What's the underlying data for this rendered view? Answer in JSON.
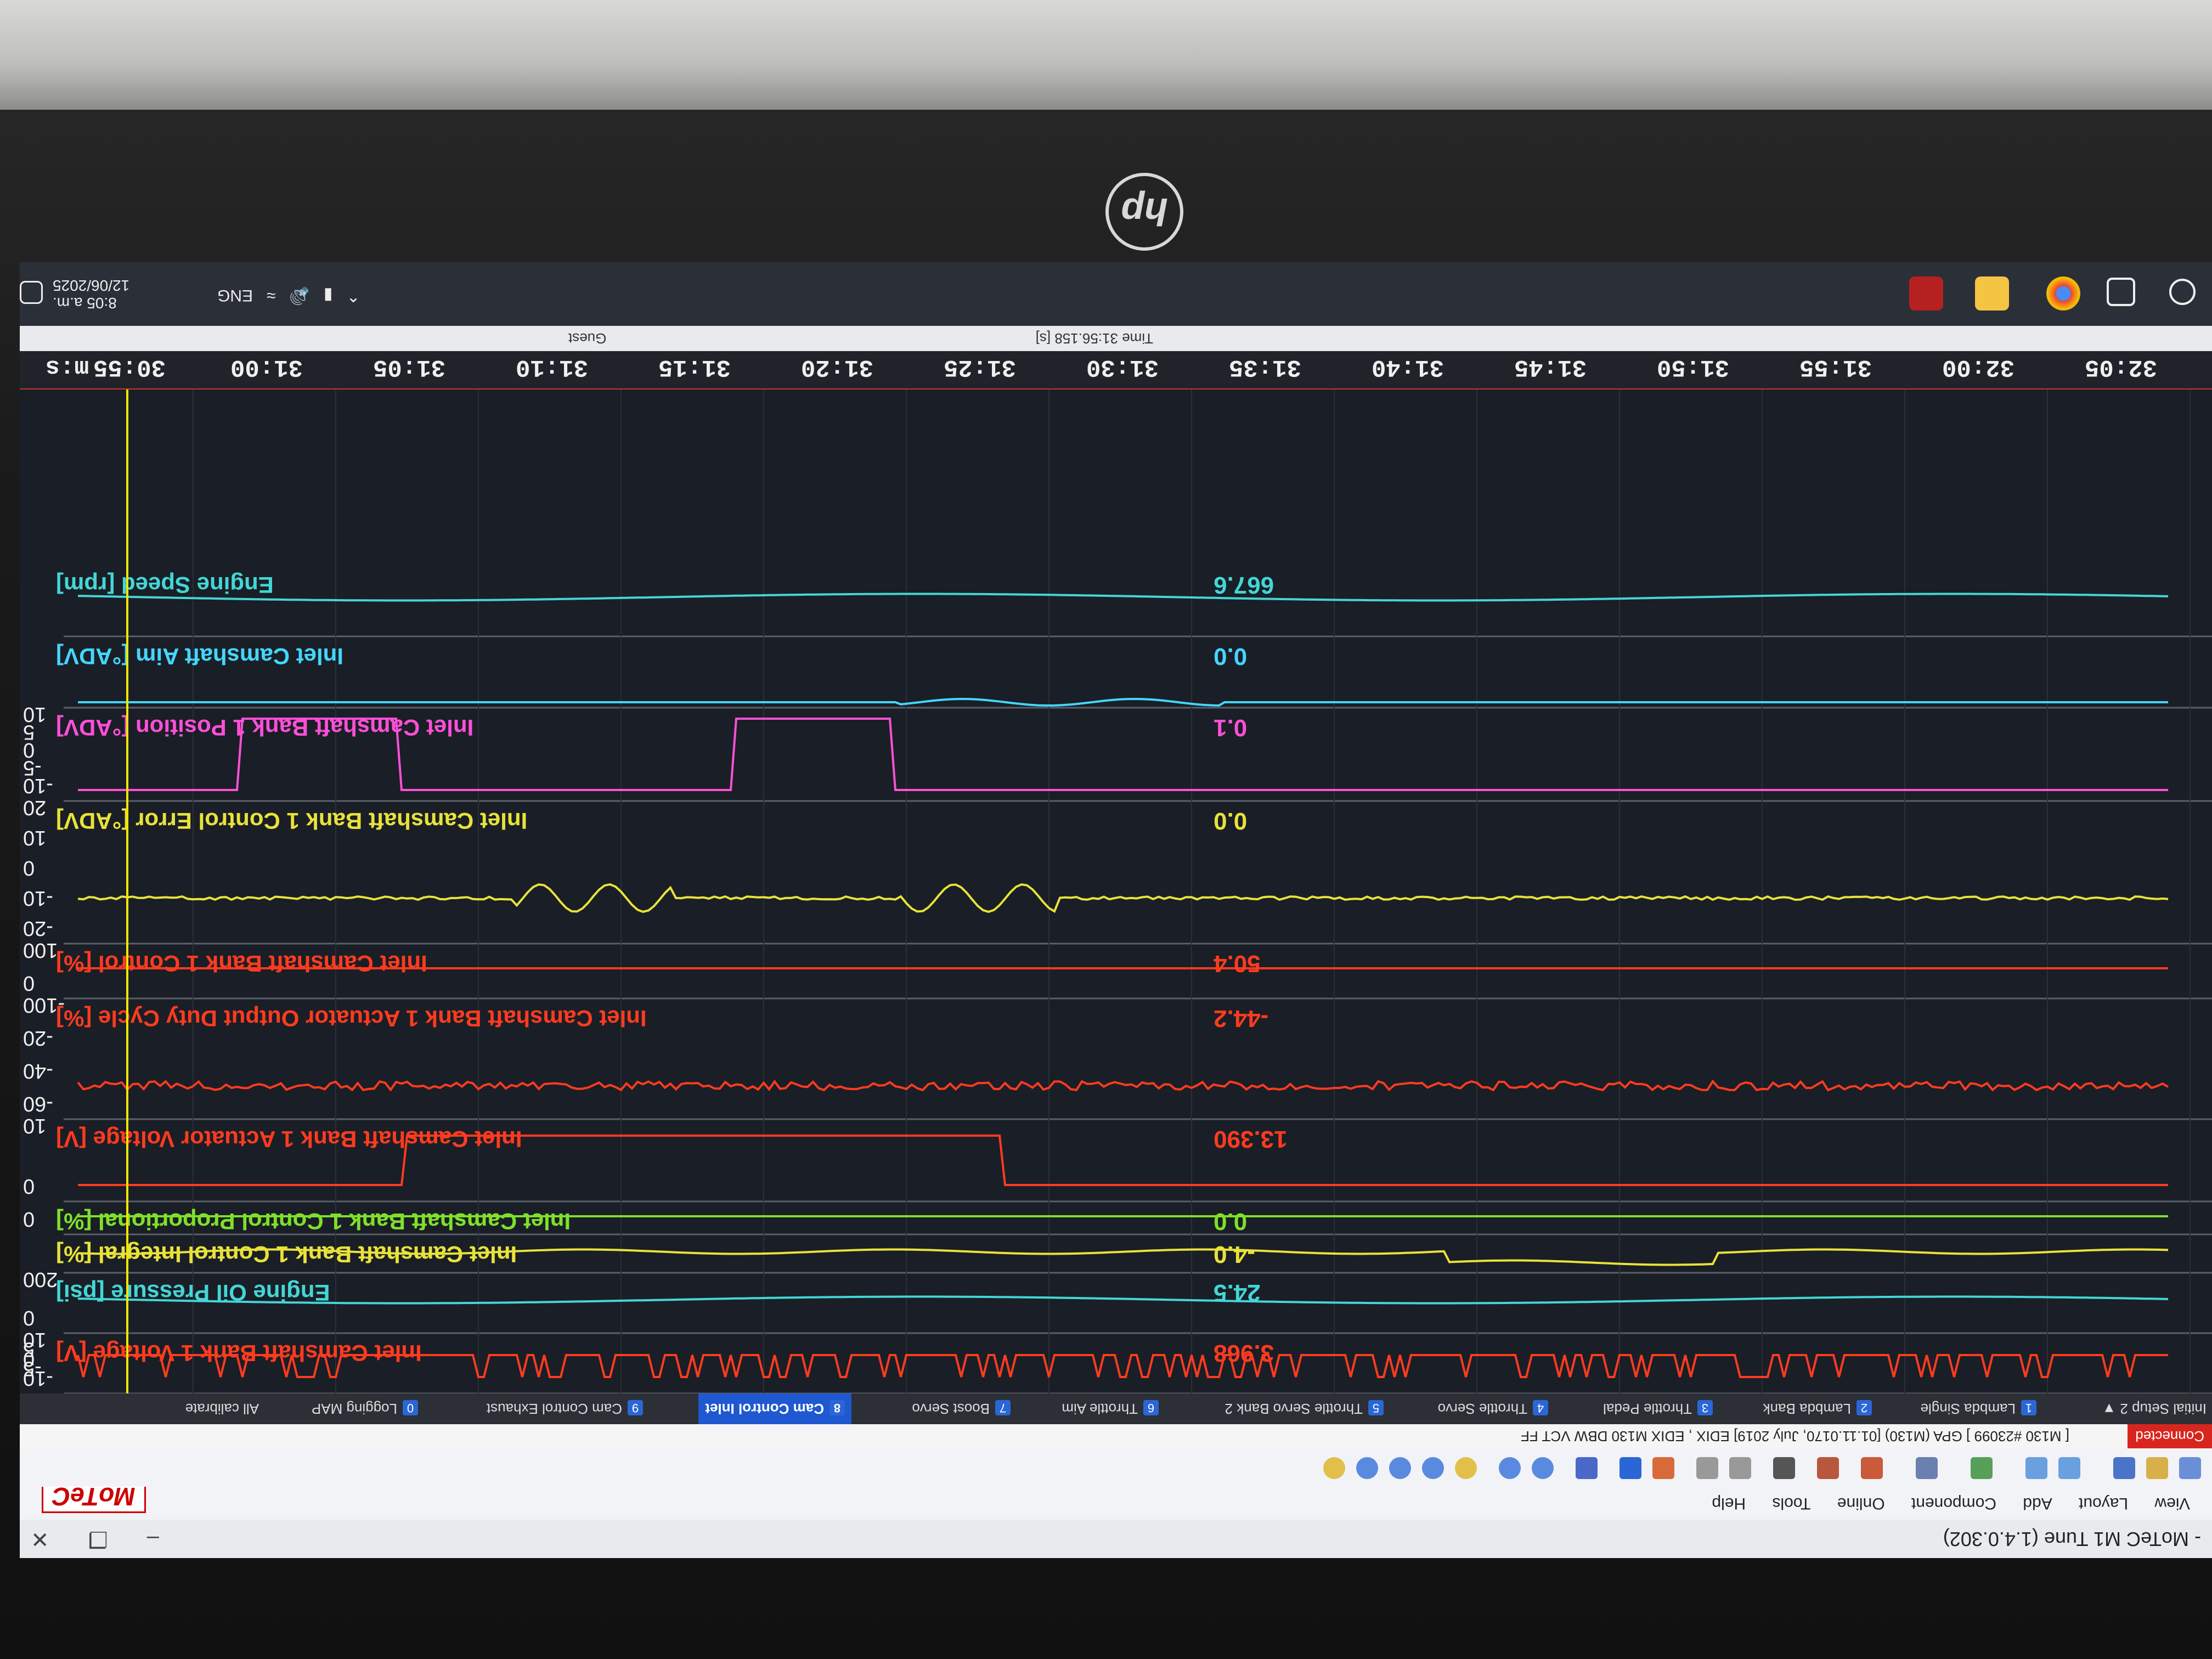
{
  "window": {
    "title": "- MoTeC M1 Tune (1.4.0.302)",
    "brand": "MoTeC"
  },
  "menu": [
    "View",
    "Layout",
    "Add",
    "Component",
    "Online",
    "Tools",
    "Help"
  ],
  "status": {
    "connection": "Connected",
    "info": "[ M130 #23099 ]   GPA (M130) [01.11.0170, July 2019]  EDIX , EDIX M130  DBW VCT FF"
  },
  "tabs": [
    {
      "num": "",
      "label": "Initial Setup 2"
    },
    {
      "num": "1",
      "label": "Lambda Single"
    },
    {
      "num": "2",
      "label": "Lambda Bank"
    },
    {
      "num": "3",
      "label": "Throttle Pedal"
    },
    {
      "num": "4",
      "label": "Throttle Servo"
    },
    {
      "num": "5",
      "label": "Throttle Servo Bank 2"
    },
    {
      "num": "6",
      "label": "Throttle Aim"
    },
    {
      "num": "7",
      "label": "Boost Servo"
    },
    {
      "num": "8",
      "label": "Cam Control Inlet"
    },
    {
      "num": "9",
      "label": "Cam Control Exhaust"
    },
    {
      "num": "0",
      "label": "Logging MAP"
    },
    {
      "num": "",
      "label": "All calibrate"
    }
  ],
  "axis": {
    "unit": "m:s",
    "ticks": [
      "30:55",
      "31:00",
      "31:05",
      "31:10",
      "31:15",
      "31:20",
      "31:25",
      "31:30",
      "31:35",
      "31:40",
      "31:45",
      "31:50",
      "31:55",
      "32:00",
      "32:05"
    ]
  },
  "timebar": {
    "time": "Time  31:56.158 [s]",
    "user": "Guest"
  },
  "taskbar": {
    "lang": "ENG",
    "clock": "8:05 a.m.",
    "date": "12/06/2025"
  },
  "channels": [
    {
      "label": "Inlet Camshaft Bank 1 Voltage [V]",
      "value": "3.968",
      "color": "#ff3b1f",
      "scale": [
        "-10",
        "-5",
        "0",
        "5",
        "10"
      ]
    },
    {
      "label": "Engine Oil Pressure [psi]",
      "value": "24.5",
      "color": "#43d6d6",
      "scale": [
        "0",
        "200"
      ]
    },
    {
      "label": "Inlet Camshaft Bank 1 Control Integral [%]",
      "value": "-4.0",
      "color": "#e8e23a",
      "scale": []
    },
    {
      "label": "Inlet Camshaft Bank 1 Control Proportional [%]",
      "value": "0.0",
      "color": "#7fe02a",
      "scale": [
        "0"
      ]
    },
    {
      "label": "Inlet Camshaft Bank 1 Actuator Voltage [V]",
      "value": "13.390",
      "color": "#ff3b1f",
      "scale": [
        "0",
        "10"
      ]
    },
    {
      "label": "Inlet Camshaft Bank 1 Actuator Output Duty Cycle [%]",
      "value": "-44.2",
      "color": "#ff3b1f",
      "scale": [
        "-60",
        "-40",
        "-20",
        "-100"
      ]
    },
    {
      "label": "Inlet Camshaft Bank 1 Control [%]",
      "value": "50.4",
      "color": "#ff3b1f",
      "scale": [
        "0",
        "100"
      ]
    },
    {
      "label": "Inlet Camshaft Bank 1 Control Error [°ADV]",
      "value": "0.0",
      "color": "#e8e23a",
      "scale": [
        "-20",
        "-10",
        "0",
        "10",
        "20"
      ]
    },
    {
      "label": "Inlet Camshaft Bank 1 Position [°ADV]",
      "value": "0.1",
      "color": "#ff4fd8",
      "scale": [
        "-10",
        "-5",
        "0",
        "5",
        "10"
      ]
    },
    {
      "label": "Inlet Camshaft Aim [°ADV]",
      "value": "0.0",
      "color": "#43d6ff",
      "scale": []
    },
    {
      "label": "Engine Speed [rpm]",
      "value": "667.6",
      "color": "#43d6d6",
      "scale": []
    }
  ],
  "cursor": {
    "color": "#f2e600"
  }
}
